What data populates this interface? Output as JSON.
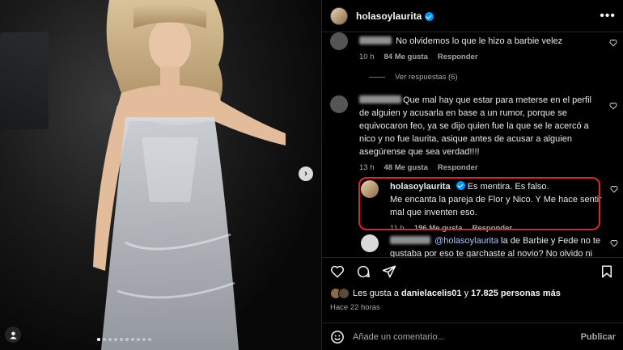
{
  "post": {
    "username": "holasoylaurita",
    "more_label": "•••",
    "next_arrow": "›",
    "carousel": {
      "count": 10,
      "active": 1
    }
  },
  "comments": [
    {
      "text": "No olvidemos lo que le hizo a barbie velez",
      "time": "10 h",
      "likes": "84 Me gusta",
      "reply": "Responder",
      "view_replies": "Ver respuestas (6)"
    },
    {
      "text": "Que mal hay que estar para meterse en el perfil de alguien y acusarla en base a un rumor, porque se equivocaron feo, ya se dijo quien fue la que se le acercó a nico y no fue laurita, asique antes de acusar a alguien asegúrense que sea verdad!!!!",
      "time": "13 h",
      "likes": "48 Me gusta",
      "reply": "Responder"
    },
    {
      "username": "holasoylaurita",
      "line1": "Es mentira. Es falso.",
      "line2": "Me encanta la pareja de Flor y Nico. Y Me hace sentir mal que inventen eso.",
      "time": "11 h",
      "likes": "196 Me gusta",
      "reply": "Responder"
    },
    {
      "mention": "@holasoylaurita",
      "text": "la de Barbie y Fede no te gustaba por eso te garchaste al novio? No olvido ni"
    }
  ],
  "footer": {
    "likes_prefix": "Les gusta a",
    "likes_user": "danielacelis01",
    "likes_middle": "y",
    "likes_count": "17.825 personas más",
    "time_ago": "Hace 22 horas",
    "comment_placeholder": "Añade un comentario...",
    "publish": "Publicar"
  },
  "colors": {
    "accent": "#0095f6",
    "highlight": "#e2252b",
    "muted": "#a8a8a8"
  },
  "icons": [
    "heart-icon",
    "comment-icon",
    "share-icon",
    "save-icon",
    "emoji-icon",
    "more-icon",
    "verified-icon",
    "user-tag-icon"
  ]
}
